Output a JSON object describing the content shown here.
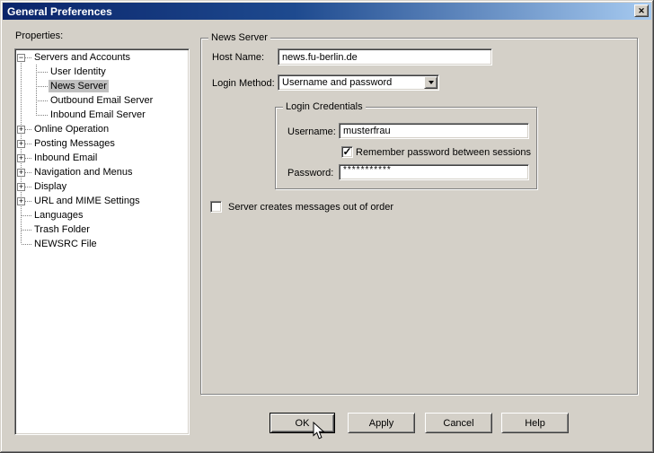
{
  "titlebar": {
    "title": "General Preferences",
    "close_glyph": "✕"
  },
  "sidebar": {
    "label": "Properties:",
    "items": [
      {
        "label": "Servers and Accounts",
        "kind": "branch",
        "glyph": "−",
        "selected": false
      },
      {
        "label": "User Identity",
        "kind": "child",
        "selected": false
      },
      {
        "label": "News Server",
        "kind": "child",
        "selected": true
      },
      {
        "label": "Outbound Email Server",
        "kind": "child",
        "selected": false
      },
      {
        "label": "Inbound Email Server",
        "kind": "child",
        "selected": false
      },
      {
        "label": "Online Operation",
        "kind": "branch",
        "glyph": "+",
        "selected": false
      },
      {
        "label": "Posting Messages",
        "kind": "branch",
        "glyph": "+",
        "selected": false
      },
      {
        "label": "Inbound Email",
        "kind": "branch",
        "glyph": "+",
        "selected": false
      },
      {
        "label": "Navigation and Menus",
        "kind": "branch",
        "glyph": "+",
        "selected": false
      },
      {
        "label": "Display",
        "kind": "branch",
        "glyph": "+",
        "selected": false
      },
      {
        "label": "URL and MIME Settings",
        "kind": "branch",
        "glyph": "+",
        "selected": false
      },
      {
        "label": "Languages",
        "kind": "leaf",
        "selected": false
      },
      {
        "label": "Trash Folder",
        "kind": "leaf",
        "selected": false
      },
      {
        "label": "NEWSRC File",
        "kind": "leaf",
        "selected": false
      }
    ]
  },
  "news_server": {
    "group_title": "News Server",
    "host_name_label": "Host Name:",
    "host_name_value": "news.fu-berlin.de",
    "login_method_label": "Login Method:",
    "login_method_value": "Username and password",
    "credentials": {
      "group_title": "Login Credentials",
      "username_label": "Username:",
      "username_value": "musterfrau",
      "remember_label": "Remember password between sessions",
      "remember_checked": true,
      "remember_glyph": "✓",
      "password_label": "Password:",
      "password_value": "***********"
    },
    "out_of_order_label": "Server creates messages out of order",
    "out_of_order_checked": false,
    "out_of_order_glyph": ""
  },
  "buttons": {
    "ok": "OK",
    "apply": "Apply",
    "cancel": "Cancel",
    "help": "Help"
  },
  "colors": {
    "titlebar_start": "#0a246a",
    "titlebar_end": "#a6caf0",
    "dialog_bg": "#d4d0c8",
    "selection_bg": "#c0c0c0",
    "field_bg": "#ffffff"
  }
}
